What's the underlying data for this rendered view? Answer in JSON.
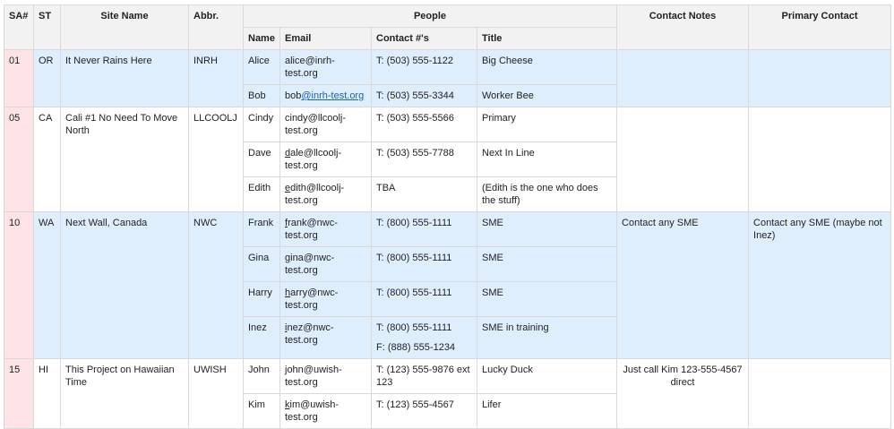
{
  "headers": {
    "sa": "SA#",
    "st": "ST",
    "site_name": "Site Name",
    "abbr": "Abbr.",
    "people": "People",
    "name": "Name",
    "email": "Email",
    "contact": "Contact #'s",
    "title": "Title",
    "contact_notes": "Contact Notes",
    "primary_contact": "Primary Contact"
  },
  "sites": [
    {
      "sa": "01",
      "st": "OR",
      "site": "It Never Rains Here",
      "abbr": "INRH",
      "notes": "",
      "primary": "",
      "people": [
        {
          "name": "Alice",
          "email": "alice@inrh-test.org",
          "phone": "T: (503) 555-1122",
          "title": "Big Cheese"
        },
        {
          "name": "Bob",
          "email_a": "bob",
          "email_b": "@inrh-test.org",
          "phone": "T: (503) 555-3344",
          "title": "Worker Bee"
        }
      ]
    },
    {
      "sa": "05",
      "st": "CA",
      "site": "Cali #1 No Need To Move North",
      "abbr": "LLCOOLJ",
      "notes": "",
      "primary": "",
      "people": [
        {
          "name": "Cindy",
          "email": "cindy@llcoolj-test.org",
          "phone": "T: (503) 555-5566",
          "title": "Primary"
        },
        {
          "name": "Dave",
          "email_a": "d",
          "email_b": "ale@llcoolj-test.org",
          "phone": "T: (503) 555-7788",
          "title": "Next In Line"
        },
        {
          "name": "Edith",
          "email_a": "e",
          "email_b": "dith@llcoolj-test.org",
          "phone": "TBA",
          "title": "(Edith is the one who does the stuff)"
        }
      ]
    },
    {
      "sa": "10",
      "st": "WA",
      "site": "Next Wall, Canada",
      "abbr": "NWC",
      "notes": "Contact any SME",
      "primary": "Contact any SME (maybe not Inez)",
      "people": [
        {
          "name": "Frank",
          "email_a": "f",
          "email_b": "rank@nwc-test.org",
          "phone": "T:  (800) 555-1111",
          "title": "SME"
        },
        {
          "name": "Gina",
          "email_a": "g",
          "email_b": "ina@nwc-test.org",
          "phone": "T:  (800) 555-1111",
          "title": "SME"
        },
        {
          "name": "Harry",
          "email_a": "h",
          "email_b": "arry@nwc-test.org",
          "phone": "T:  (800) 555-1111",
          "title": "SME"
        },
        {
          "name": "Inez",
          "email_a": "i",
          "email_b": "nez@nwc-test.org",
          "phone": "T:  (800) 555-1111",
          "fax": "F: (888) 555-1234",
          "title": "SME in training"
        }
      ]
    },
    {
      "sa": "15",
      "st": "HI",
      "site": "This Project on Hawaiian Time",
      "abbr": "UWISH",
      "notes": "Just call Kim 123-555-4567 direct",
      "primary": "",
      "people": [
        {
          "name": "John",
          "email": "john@uwish-test.org",
          "phone": "T:  (123) 555-9876 ext 123",
          "title": "Lucky Duck"
        },
        {
          "name": "Kim",
          "email_a": "k",
          "email_b": "im@uwish-test.org",
          "phone": "T: (123) 555-4567",
          "title": "Lifer"
        }
      ]
    }
  ]
}
